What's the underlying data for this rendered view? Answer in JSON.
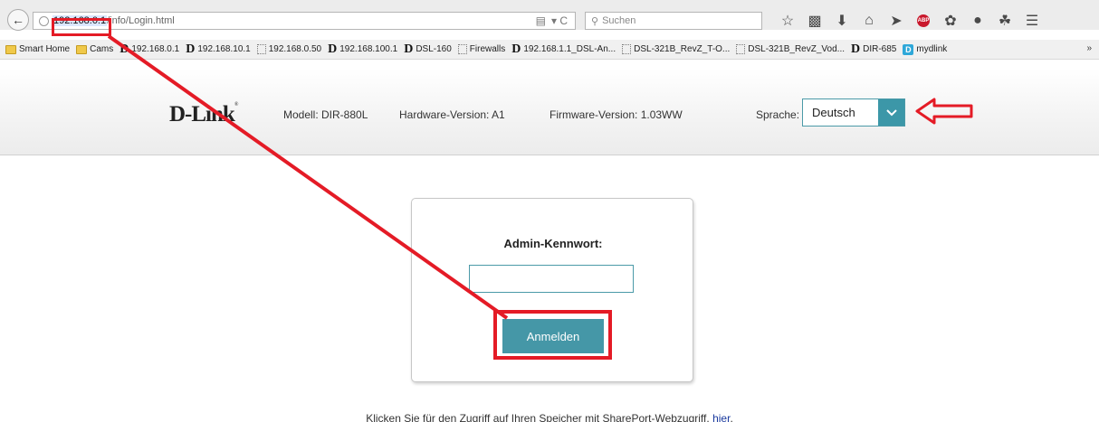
{
  "browser": {
    "url_host": "192.168.0.1",
    "url_path": "/info/Login.html",
    "search_placeholder": "Suchen",
    "url_controls": "▾ C"
  },
  "bookmarks": [
    {
      "icon": "folder-icon",
      "label": "Smart Home"
    },
    {
      "icon": "folder-icon",
      "label": "Cams"
    },
    {
      "icon": "dlink-icon",
      "label": "192.168.0.1"
    },
    {
      "icon": "dlink-icon",
      "label": "192.168.10.1"
    },
    {
      "icon": "page-icon",
      "label": "192.168.0.50"
    },
    {
      "icon": "dlink-icon",
      "label": "192.168.100.1"
    },
    {
      "icon": "dlink-icon",
      "label": "DSL-160"
    },
    {
      "icon": "page-icon",
      "label": "Firewalls"
    },
    {
      "icon": "dlink-icon",
      "label": "192.168.1.1_DSL-An..."
    },
    {
      "icon": "page-icon",
      "label": "DSL-321B_RevZ_T-O..."
    },
    {
      "icon": "page-icon",
      "label": "DSL-321B_RevZ_Vod..."
    },
    {
      "icon": "dlink-icon",
      "label": "DIR-685"
    },
    {
      "icon": "mydlink-icon",
      "label": "mydlink"
    }
  ],
  "header": {
    "logo": "D-Link",
    "model": "Modell: DIR-880L",
    "hardware": "Hardware-Version: A1",
    "firmware": "Firmware-Version: 1.03WW",
    "language_label": "Sprache:",
    "language_value": "Deutsch"
  },
  "login": {
    "label": "Admin-Kennwort:",
    "password_value": "",
    "button_label": "Anmelden"
  },
  "footer": {
    "text": "Klicken Sie für den Zugriff auf Ihren Speicher mit SharePort-Webzugriff.",
    "link": "hier"
  },
  "colors": {
    "accent": "#4597a7",
    "annotation": "#e41b26"
  }
}
